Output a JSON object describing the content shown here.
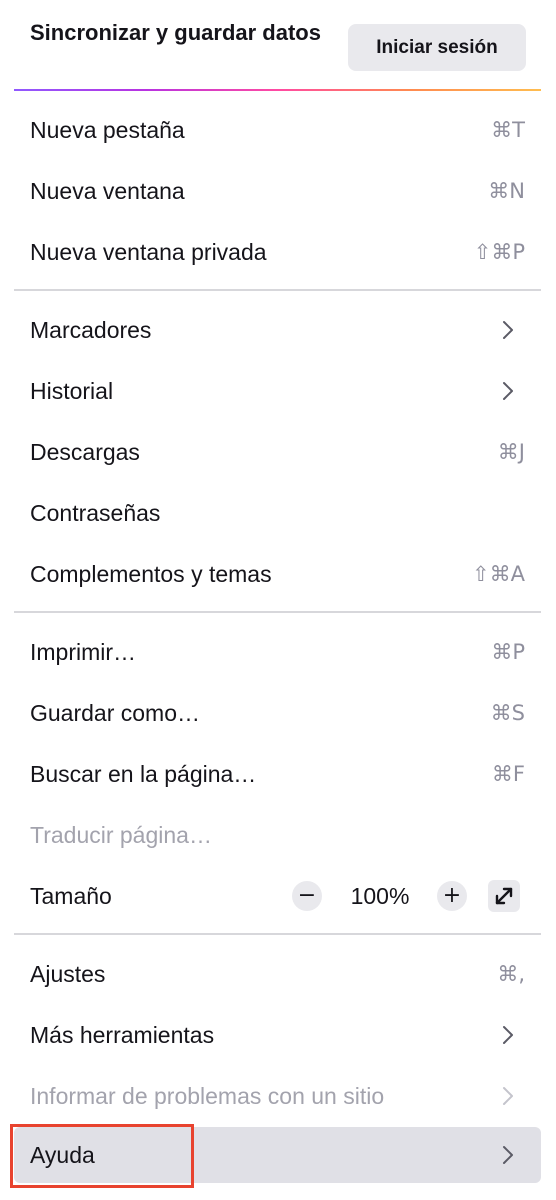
{
  "sync": {
    "title": "Sincronizar y guardar datos",
    "signin_label": "Iniciar sesión"
  },
  "group1": [
    {
      "label": "Nueva pestaña",
      "shortcut": "⌘T"
    },
    {
      "label": "Nueva ventana",
      "shortcut": "⌘N"
    },
    {
      "label": "Nueva ventana privada",
      "shortcut": "⇧⌘P"
    }
  ],
  "group2": [
    {
      "label": "Marcadores",
      "icon": "chevron-right-icon"
    },
    {
      "label": "Historial",
      "icon": "chevron-right-icon"
    },
    {
      "label": "Descargas",
      "shortcut": "⌘J"
    },
    {
      "label": "Contraseñas"
    },
    {
      "label": "Complementos y temas",
      "shortcut": "⇧⌘A"
    }
  ],
  "group3": [
    {
      "label": "Imprimir…",
      "shortcut": "⌘P"
    },
    {
      "label": "Guardar como…",
      "shortcut": "⌘S"
    },
    {
      "label": "Buscar en la página…",
      "shortcut": "⌘F"
    },
    {
      "label": "Traducir página…",
      "disabled": true
    }
  ],
  "zoom": {
    "label": "Tamaño",
    "minus": "−",
    "value": "100%",
    "plus": "+",
    "fullscreen_icon": "fullscreen-icon"
  },
  "group4": [
    {
      "label": "Ajustes",
      "shortcut": "⌘,"
    },
    {
      "label": "Más herramientas",
      "icon": "chevron-right-icon"
    },
    {
      "label": "Informar de problemas con un sitio",
      "icon": "chevron-right-icon",
      "disabled": true
    },
    {
      "label": "Ayuda",
      "icon": "chevron-right-icon",
      "hovered": true
    }
  ],
  "colors": {
    "highlight_box": "#e8432f",
    "hover_background": "#e0e0e6",
    "disabled_text": "#a3a3ad",
    "shortcut_text": "#8f8f9d"
  }
}
